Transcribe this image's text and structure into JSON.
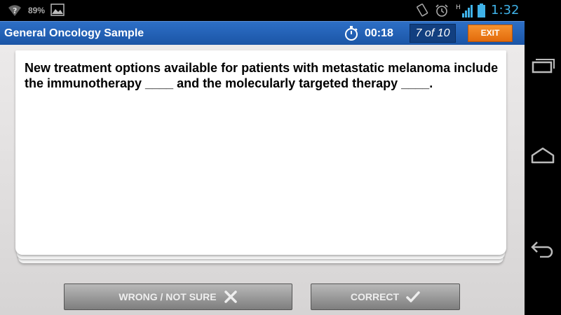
{
  "status_bar": {
    "battery_percent": "89%",
    "time": "1:32",
    "icons": [
      "wifi-question-icon",
      "gallery-icon",
      "vibrate-icon",
      "alarm-icon",
      "signal-icon",
      "battery-icon"
    ]
  },
  "header": {
    "title": "General Oncology Sample",
    "timer": "00:18",
    "progress": "7 of 10",
    "exit_label": "EXIT"
  },
  "card": {
    "question": "New treatment options available for patients with metastatic melanoma include the immunotherapy ____ and the molecularly targeted therapy ____."
  },
  "actions": {
    "wrong_label": "WRONG / NOT SURE",
    "correct_label": "CORRECT"
  },
  "nav_bar": {
    "icons": [
      "recent-apps-icon",
      "home-icon",
      "back-icon"
    ]
  },
  "colors": {
    "header_blue": "#1b55a6",
    "exit_orange": "#f07d1a",
    "clock_blue": "#3fb2e8"
  }
}
